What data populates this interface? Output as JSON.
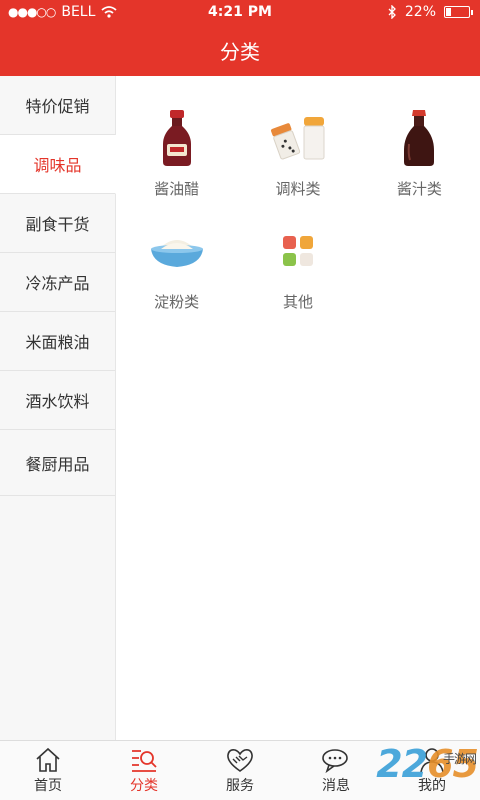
{
  "status_bar": {
    "carrier": "BELL",
    "time": "4:21 PM",
    "battery": "22%",
    "battery_level": 0.22
  },
  "header": {
    "title": "分类"
  },
  "sidebar": {
    "items": [
      {
        "label": "特价促销"
      },
      {
        "label": "调味品"
      },
      {
        "label": "副食干货"
      },
      {
        "label": "冷冻产品"
      },
      {
        "label": "米面粮油"
      },
      {
        "label": "酒水饮料"
      },
      {
        "label": "餐厨用品"
      }
    ],
    "active_index": 1
  },
  "categories": [
    {
      "label": "酱油醋",
      "icon": "soy-sauce-bottle-icon"
    },
    {
      "label": "调料类",
      "icon": "spice-shakers-icon"
    },
    {
      "label": "酱汁类",
      "icon": "sauce-bottle-icon"
    },
    {
      "label": "淀粉类",
      "icon": "starch-bowl-icon"
    },
    {
      "label": "其他",
      "icon": "other-grid-icon"
    }
  ],
  "tab_bar": {
    "tabs": [
      {
        "label": "首页",
        "icon": "home-icon"
      },
      {
        "label": "分类",
        "icon": "category-search-icon"
      },
      {
        "label": "服务",
        "icon": "handshake-icon"
      },
      {
        "label": "消息",
        "icon": "chat-icon"
      },
      {
        "label": "我的",
        "icon": "user-icon"
      }
    ],
    "active_index": 1
  },
  "watermark": {
    "text_a": "22",
    "text_b": "65",
    "sub": "手游网"
  },
  "colors": {
    "accent": "#e4352a"
  }
}
